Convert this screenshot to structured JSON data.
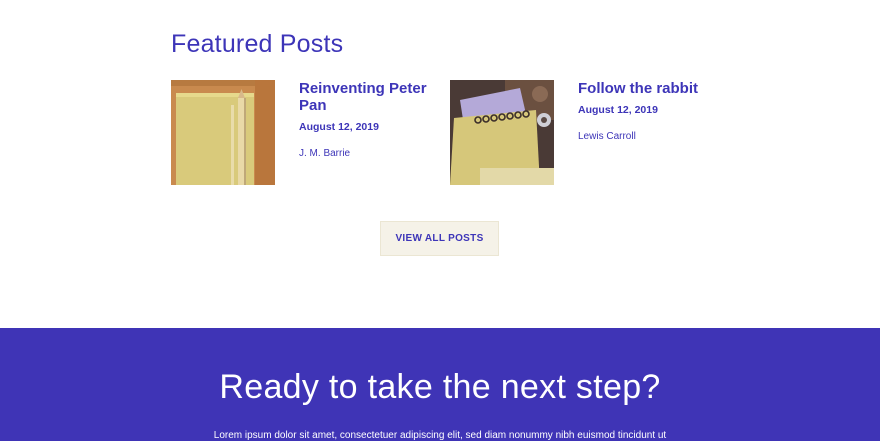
{
  "featured": {
    "title": "Featured Posts",
    "posts": [
      {
        "title": "Reinventing Peter Pan",
        "date": "August 12, 2019",
        "author": "J. M. Barrie",
        "image": "notebook-pencil-photo"
      },
      {
        "title": "Follow the rabbit",
        "date": "August 12, 2019",
        "author": "Lewis Carroll",
        "image": "spiral-notebook-photo"
      }
    ],
    "view_all_label": "VIEW ALL POSTS"
  },
  "cta": {
    "heading": "Ready to take the next step?",
    "text": "Lorem ipsum dolor sit amet, consectetuer adipiscing elit, sed diam nonummy nibh euismod tincidunt ut"
  },
  "colors": {
    "accent": "#3d35b8",
    "cta_background": "#3f34b6",
    "button_background": "#f5f2e8"
  }
}
